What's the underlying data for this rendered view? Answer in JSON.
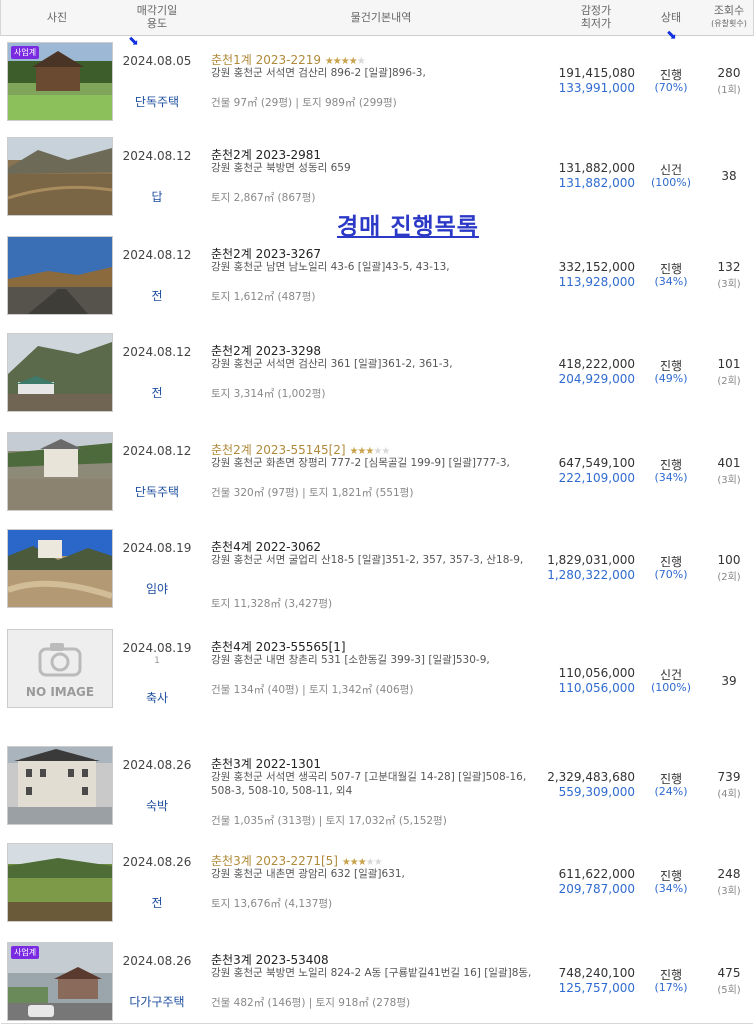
{
  "header": {
    "photo": "사진",
    "date_line1": "매각기일",
    "date_line2": "용도",
    "info": "물건기본내역",
    "price_line1": "감정가",
    "price_line2": "최저가",
    "status": "상태",
    "views_line1": "조회수",
    "views_line2": "(유찰횟수)"
  },
  "overlay_text": "경매 진행목록",
  "badge_label": "사업계",
  "noimage_label": "NO IMAGE",
  "colors": {
    "accent_blue": "#2f6bd0",
    "gold": "#b08a3a",
    "badge_purple": "#7a2be2",
    "overlay": "#2b39c6"
  },
  "rows": [
    {
      "date": "2024.08.05",
      "usage": "단독주택",
      "title": "춘천1계 2023-2219",
      "gold": true,
      "stars": 3.5,
      "addr": "강원 홍천군 서석면 검산리 896-2  [일괄]896-3,",
      "area": "건물 97㎡ (29평)  |  토지 989㎡ (299평)",
      "appraisal": "191,415,080",
      "min": "133,991,000",
      "status": "진행",
      "rate": "(70%)",
      "views": "280",
      "fails": "(1회)",
      "badge": true,
      "photo": "house1"
    },
    {
      "date": "2024.08.12",
      "usage": "답",
      "title": "춘천2계 2023-2981",
      "gold": false,
      "stars": 0,
      "addr": "강원 홍천군 북방면 성동리 659",
      "area": "토지 2,867㎡ (867평)",
      "appraisal": "131,882,000",
      "min": "131,882,000",
      "status": "신건",
      "rate": "(100%)",
      "views": "38",
      "fails": "",
      "badge": false,
      "photo": "field1"
    },
    {
      "date": "2024.08.12",
      "usage": "전",
      "title": "춘천2계 2023-3267",
      "gold": false,
      "stars": 0,
      "addr": "강원 홍천군 남면 남노일리 43-6  [일괄]43-5, 43-13,",
      "area": "토지 1,612㎡ (487평)",
      "appraisal": "332,152,000",
      "min": "113,928,000",
      "status": "진행",
      "rate": "(34%)",
      "views": "132",
      "fails": "(3회)",
      "badge": false,
      "photo": "road"
    },
    {
      "date": "2024.08.12",
      "usage": "전",
      "title": "춘천2계 2023-3298",
      "gold": false,
      "stars": 0,
      "addr": "강원 홍천군 서석면 검산리 361  [일괄]361-2, 361-3,",
      "area": "토지 3,314㎡ (1,002평)",
      "appraisal": "418,222,000",
      "min": "204,929,000",
      "status": "진행",
      "rate": "(49%)",
      "views": "101",
      "fails": "(2회)",
      "badge": false,
      "photo": "hill"
    },
    {
      "date": "2024.08.12",
      "usage": "단독주택",
      "title": "춘천2계 2023-55145[2]",
      "gold": true,
      "stars": 3,
      "addr": "강원 홍천군 화촌면 장평리 777-2 [심목골길 199-9]  [일괄]777-3,",
      "area": "건물 320㎡ (97평)  |  토지 1,821㎡ (551평)",
      "appraisal": "647,549,100",
      "min": "222,109,000",
      "status": "진행",
      "rate": "(34%)",
      "views": "401",
      "fails": "(3회)",
      "badge": false,
      "photo": "house2"
    },
    {
      "date": "2024.08.19",
      "usage": "임야",
      "title": "춘천4계 2022-3062",
      "gold": false,
      "stars": 0,
      "addr": "강원 홍천군 서면 굴업리 산18-5  [일괄]351-2, 357, 357-3, 산18-9,",
      "area": "토지 11,328㎡ (3,427평)",
      "appraisal": "1,829,031,000",
      "min": "1,280,322,000",
      "status": "진행",
      "rate": "(70%)",
      "views": "100",
      "fails": "(2회)",
      "badge": false,
      "photo": "forest"
    },
    {
      "date": "2024.08.19",
      "usage": "축사",
      "title": "춘천4계 2023-55565[1]",
      "gold": false,
      "stars": 0,
      "addr": "강원 홍천군 내면 창촌리 531 [소한동길 399-3]  [일괄]530-9,",
      "area": "건물 134㎡ (40평)  |  토지 1,342㎡ (406평)",
      "appraisal": "110,056,000",
      "min": "110,056,000",
      "status": "신건",
      "rate": "(100%)",
      "views": "39",
      "fails": "",
      "badge": false,
      "photo": "noimage",
      "date_sub": "1"
    },
    {
      "date": "2024.08.26",
      "usage": "숙박",
      "title": "춘천3계 2022-1301",
      "gold": false,
      "stars": 0,
      "addr": "강원 홍천군 서석면 생곡리 507-7 [고분대월길 14-28]  [일괄]508-16, 508-3, 508-10, 508-11, 외4",
      "area": "건물 1,035㎡ (313평)  |  토지 17,032㎡ (5,152평)",
      "appraisal": "2,329,483,680",
      "min": "559,309,000",
      "status": "진행",
      "rate": "(24%)",
      "views": "739",
      "fails": "(4회)",
      "badge": false,
      "photo": "hotel"
    },
    {
      "date": "2024.08.26",
      "usage": "전",
      "title": "춘천3계 2023-2271[5]",
      "gold": true,
      "stars": 3,
      "addr": "강원 홍천군 내촌면 광암리 632  [일괄]631,",
      "area": "토지 13,676㎡ (4,137평)",
      "appraisal": "611,622,000",
      "min": "209,787,000",
      "status": "진행",
      "rate": "(34%)",
      "views": "248",
      "fails": "(3회)",
      "badge": false,
      "photo": "field2"
    },
    {
      "date": "2024.08.26",
      "usage": "다가구주택",
      "title": "춘천3계 2023-53408",
      "gold": false,
      "stars": 0,
      "addr": "강원 홍천군 북방면 노일리 824-2 A동 [구룡밭길41번길 16]  [일괄]8동,",
      "area": "건물 482㎡ (146평)  |  토지 918㎡ (278평)",
      "appraisal": "748,240,100",
      "min": "125,757,000",
      "status": "진행",
      "rate": "(17%)",
      "views": "475",
      "fails": "(5회)",
      "badge": true,
      "photo": "village"
    }
  ]
}
